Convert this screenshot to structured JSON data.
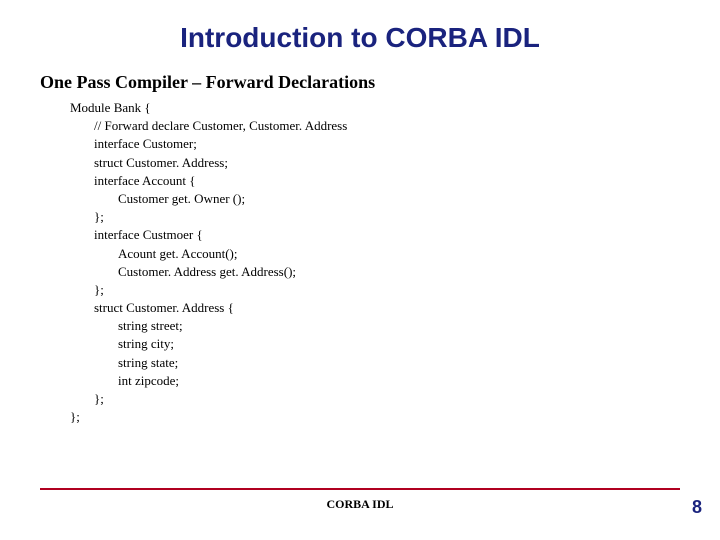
{
  "title": "Introduction to CORBA IDL",
  "subtitle": "One Pass Compiler – Forward Declarations",
  "code": [
    {
      "t": "Module Bank {",
      "i": 0
    },
    {
      "t": "// Forward declare Customer, Customer. Address",
      "i": 1
    },
    {
      "t": "interface Customer;",
      "i": 1
    },
    {
      "t": "struct Customer. Address;",
      "i": 1
    },
    {
      "t": "interface Account {",
      "i": 1
    },
    {
      "t": "Customer get. Owner ();",
      "i": 2
    },
    {
      "t": "};",
      "i": 1
    },
    {
      "t": "interface Custmoer {",
      "i": 1
    },
    {
      "t": "Acount get. Account();",
      "i": 2
    },
    {
      "t": "Customer. Address get. Address();",
      "i": 2
    },
    {
      "t": "};",
      "i": 1
    },
    {
      "t": "struct Customer. Address {",
      "i": 1
    },
    {
      "t": "string street;",
      "i": 2
    },
    {
      "t": "string city;",
      "i": 2
    },
    {
      "t": "string state;",
      "i": 2
    },
    {
      "t": "int zipcode;",
      "i": 2
    },
    {
      "t": "};",
      "i": 1
    },
    {
      "t": "};",
      "i": 0
    }
  ],
  "footer": "CORBA IDL",
  "page": "8"
}
